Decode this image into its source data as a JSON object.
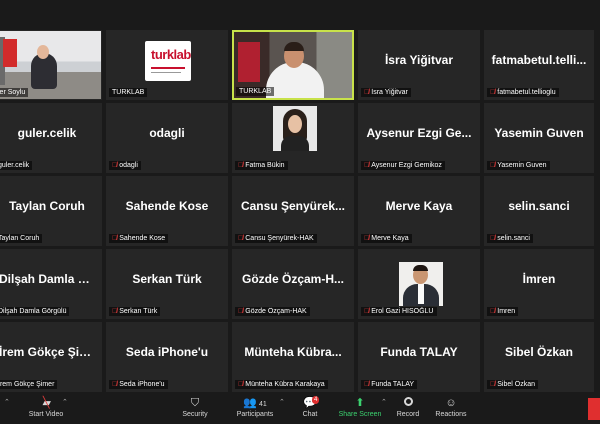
{
  "tiles": [
    {
      "id": "r1c1",
      "big": "",
      "label": "ler Soylu",
      "muted": false,
      "kind": "room"
    },
    {
      "id": "r1c2",
      "big": "",
      "label": "TURKLAB",
      "muted": false,
      "kind": "logo",
      "logo_text": "turklab"
    },
    {
      "id": "r1c3",
      "big": "",
      "label": "TURKLAB",
      "muted": false,
      "kind": "office",
      "active": true
    },
    {
      "id": "r1c4",
      "big": "İsra Yiğitvar",
      "label": "İsra Yiğitvar",
      "muted": true
    },
    {
      "id": "r1c5",
      "big": "fatmabetul.telli...",
      "label": "fatmabetul.tellioglu",
      "muted": true
    },
    {
      "id": "r2c1",
      "big": "guler.celik",
      "label": "guler.celik",
      "muted": false
    },
    {
      "id": "r2c2",
      "big": "odagli",
      "label": "odagli",
      "muted": true
    },
    {
      "id": "r2c3",
      "big": "",
      "label": "Fatma Bükin",
      "muted": true,
      "kind": "photo-f"
    },
    {
      "id": "r2c4",
      "big": "Aysenur Ezgi Ge...",
      "label": "Aysenur Ezgi Gemikoz",
      "muted": true
    },
    {
      "id": "r2c5",
      "big": "Yasemin Guven",
      "label": "Yasemin Guven",
      "muted": true
    },
    {
      "id": "r3c1",
      "big": "Taylan Coruh",
      "label": "Taylan Coruh",
      "muted": false
    },
    {
      "id": "r3c2",
      "big": "Sahende Kose",
      "label": "Sahende Kose",
      "muted": true
    },
    {
      "id": "r3c3",
      "big": "Cansu Şenyürek...",
      "label": "Cansu Şenyürek-HAK",
      "muted": true
    },
    {
      "id": "r3c4",
      "big": "Merve Kaya",
      "label": "Merve Kaya",
      "muted": true
    },
    {
      "id": "r3c5",
      "big": "selin.sanci",
      "label": "selin.sanci",
      "muted": true
    },
    {
      "id": "r4c1",
      "big": "Dilşah Damla G...",
      "label": "Dilşah Damla Görgülü",
      "muted": false
    },
    {
      "id": "r4c2",
      "big": "Serkan Türk",
      "label": "Serkan Türk",
      "muted": true
    },
    {
      "id": "r4c3",
      "big": "Gözde Özçam-H...",
      "label": "Gözde Özçam-HAK",
      "muted": true
    },
    {
      "id": "r4c4",
      "big": "",
      "label": "Erol Gazi HISOĞLU",
      "muted": true,
      "kind": "photo-e"
    },
    {
      "id": "r4c5",
      "big": "İmren",
      "label": "İmren",
      "muted": true
    },
    {
      "id": "r5c1",
      "big": "İrem Gökçe Şimer",
      "label": "İrem Gökçe Şimer",
      "muted": false
    },
    {
      "id": "r5c2",
      "big": "Seda iPhone'u",
      "label": "Seda iPhone'u",
      "muted": true
    },
    {
      "id": "r5c3",
      "big": "Münteha Kübra...",
      "label": "Münteha Kübra Karakaya",
      "muted": true
    },
    {
      "id": "r5c4",
      "big": "Funda TALAY",
      "label": "Funda TALAY",
      "muted": true
    },
    {
      "id": "r5c5",
      "big": "Sibel Özkan",
      "label": "Sibel Özkan",
      "muted": true
    }
  ],
  "toolbar": {
    "start_video": "Start Video",
    "security": "Security",
    "participants": "Participants",
    "participants_count": "41",
    "chat": "Chat",
    "chat_badge": "4",
    "share_screen": "Share Screen",
    "record": "Record",
    "reactions": "Reactions"
  },
  "colors": {
    "active_border": "#c8e24a",
    "share_green": "#3bd16f",
    "mute_red": "#e03b3b"
  }
}
